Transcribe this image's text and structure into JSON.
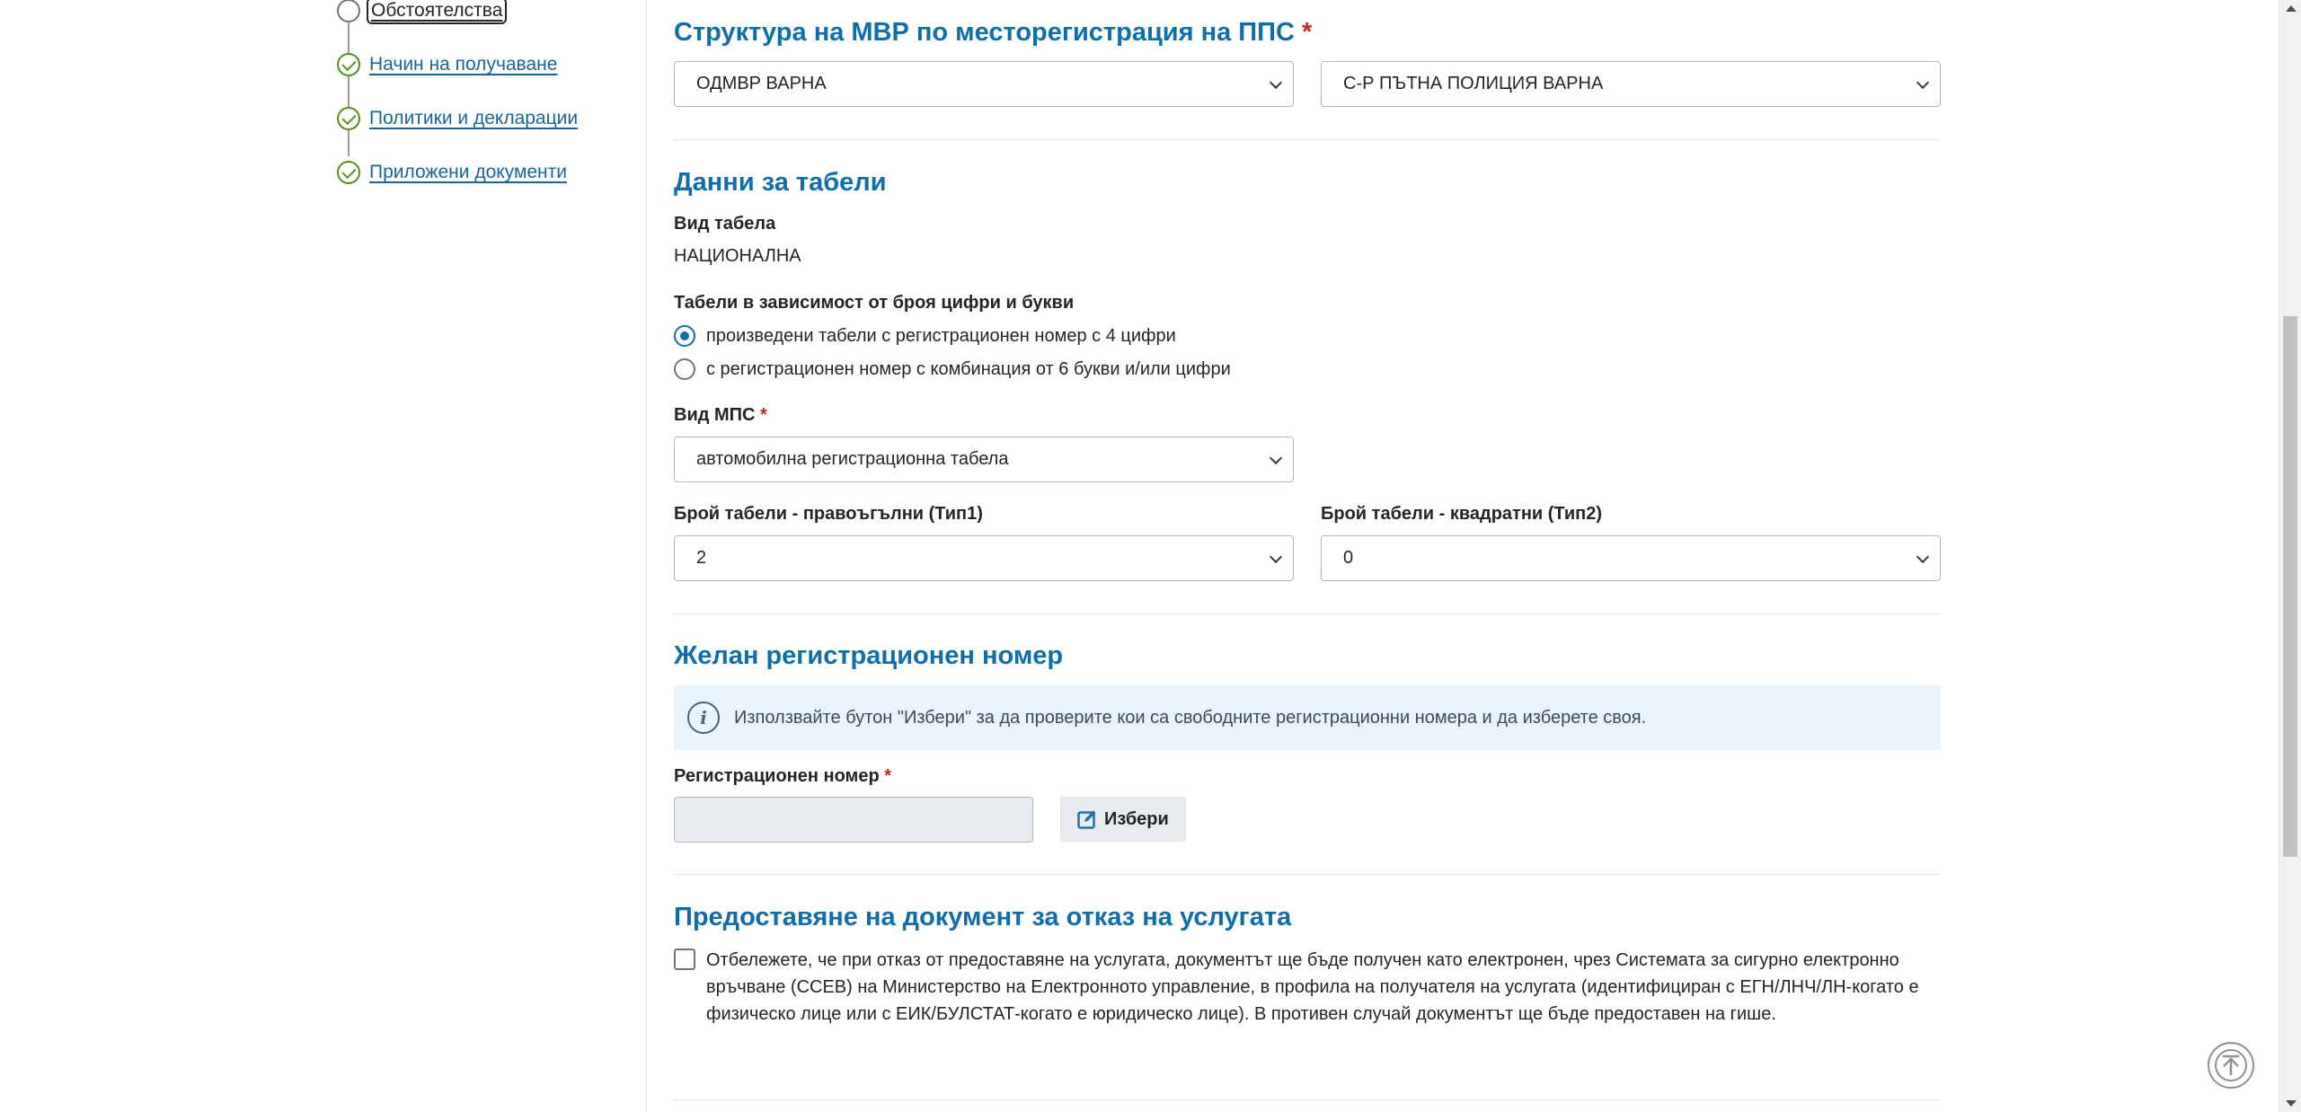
{
  "steps": [
    {
      "label": "Обстоятелства",
      "state": "current"
    },
    {
      "label": "Начин на получаване",
      "state": "done"
    },
    {
      "label": "Политики и декларации",
      "state": "done"
    },
    {
      "label": "Приложени документи",
      "state": "done"
    }
  ],
  "structure": {
    "title": "Структура на МВР по месторегистрация на ППС",
    "required_mark": "*",
    "directorate": "ОДМВР ВАРНА",
    "sector": "С-Р ПЪТНА ПОЛИЦИЯ ВАРНА"
  },
  "plates": {
    "title": "Данни за табели",
    "plate_type_label": "Вид табела",
    "plate_type_value": "НАЦИОНАЛНА",
    "by_digits_label": "Табели в зависимост от броя цифри и букви",
    "options": [
      {
        "label": "произведени табели с регистрационен номер с 4 цифри",
        "selected": true
      },
      {
        "label": "с регистрационен номер с комбинация от 6 букви и/или цифри",
        "selected": false
      }
    ],
    "vehicle_type_label": "Вид МПС",
    "vehicle_type_value": "автомобилна регистрационна табела",
    "rect_count_label": "Брой табели - правоъгълни (Тип1)",
    "rect_count_value": "2",
    "square_count_label": "Брой табели - квадратни (Тип2)",
    "square_count_value": "0"
  },
  "desired_number": {
    "title": "Желан регистрационен номер",
    "info_text": "Използвайте бутон \"Избери\" за да проверите кои са свободните регистрационни номера и да изберете своя.",
    "reg_number_label": "Регистрационен номер",
    "reg_number_value": "",
    "choose_button": "Избери"
  },
  "refusal": {
    "title": "Предоставяне на документ за отказ на услугата",
    "checked": false,
    "text": "Отбележете, че при отказ от предоставяне на услугата, документът ще бъде получен като електронен, чрез Системата за сигурно електронно връчване (ССЕВ) на Министерство на Електронното управление, в профила на получателя на услугата (идентифициран с ЕГН/ЛНЧ/ЛН-когато е физическо лице или с ЕИК/БУЛСТАТ-когато е юридическо лице). В противен случай документът ще бъде предоставен на гише."
  },
  "colors": {
    "accent": "#0f6ea8",
    "step_done": "#5a8c1f",
    "required": "#c62828",
    "info_bg": "#e8f3fb"
  },
  "icons": {
    "step_done": "check-circle-icon",
    "info": "info-icon",
    "choose": "edit-square-icon",
    "back_to_top": "arrow-up-circle-icon"
  }
}
